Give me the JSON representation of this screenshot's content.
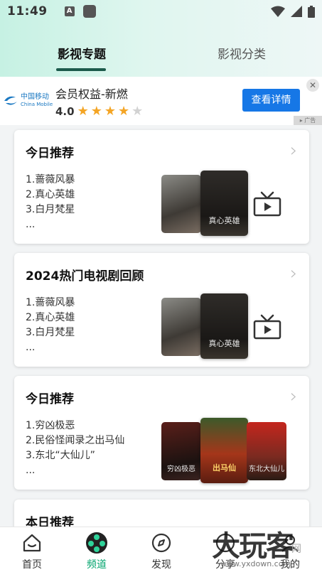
{
  "status_bar": {
    "time": "11:49",
    "a_badge": "A"
  },
  "tabs": [
    {
      "label": "影视专题",
      "active": true
    },
    {
      "label": "影视分类",
      "active": false
    }
  ],
  "ad": {
    "logo_cn": "中国移动",
    "logo_en": "China Mobile",
    "title": "会员权益-新燃",
    "rating": "4.0",
    "stars_filled": 4,
    "stars_total": 5,
    "button": "查看详情",
    "close": "✕",
    "tag": "▸ 广告"
  },
  "cards": [
    {
      "title": "今日推荐",
      "items": [
        "1.蔷薇风暴",
        "2.真心英雄",
        "3.白月梵星",
        "..."
      ]
    },
    {
      "title": "2024热门电视剧回顾",
      "items": [
        "1.蔷薇风暴",
        "2.真心英雄",
        "3.白月梵星",
        "..."
      ]
    },
    {
      "title": "今日推荐",
      "items": [
        "1.穷凶极恶",
        "2.民俗怪闻录之出马仙",
        "3.东北“大仙儿”",
        "..."
      ],
      "poster_captions": [
        "穷凶极恶",
        "出马仙",
        "东北大仙儿"
      ]
    },
    {
      "title": "本日推荐",
      "items": []
    }
  ],
  "poster_captions_common": {
    "main": "真心英雄"
  },
  "colors": {
    "accent": "#00a36c",
    "ad_button": "#1677e6",
    "tab_indicator": "#1c5a4b"
  },
  "bottom_nav": [
    {
      "label": "首页",
      "icon": "home-icon",
      "active": false
    },
    {
      "label": "频道",
      "icon": "film-reel-icon",
      "active": true
    },
    {
      "label": "发现",
      "icon": "compass-icon",
      "active": false
    },
    {
      "label": "分享",
      "icon": "share-icon",
      "active": false
    },
    {
      "label": "我的",
      "icon": "user-icon",
      "active": false
    }
  ],
  "watermark": {
    "big": "大玩客",
    "small": "www.yxdown.com",
    "small2": "网"
  }
}
